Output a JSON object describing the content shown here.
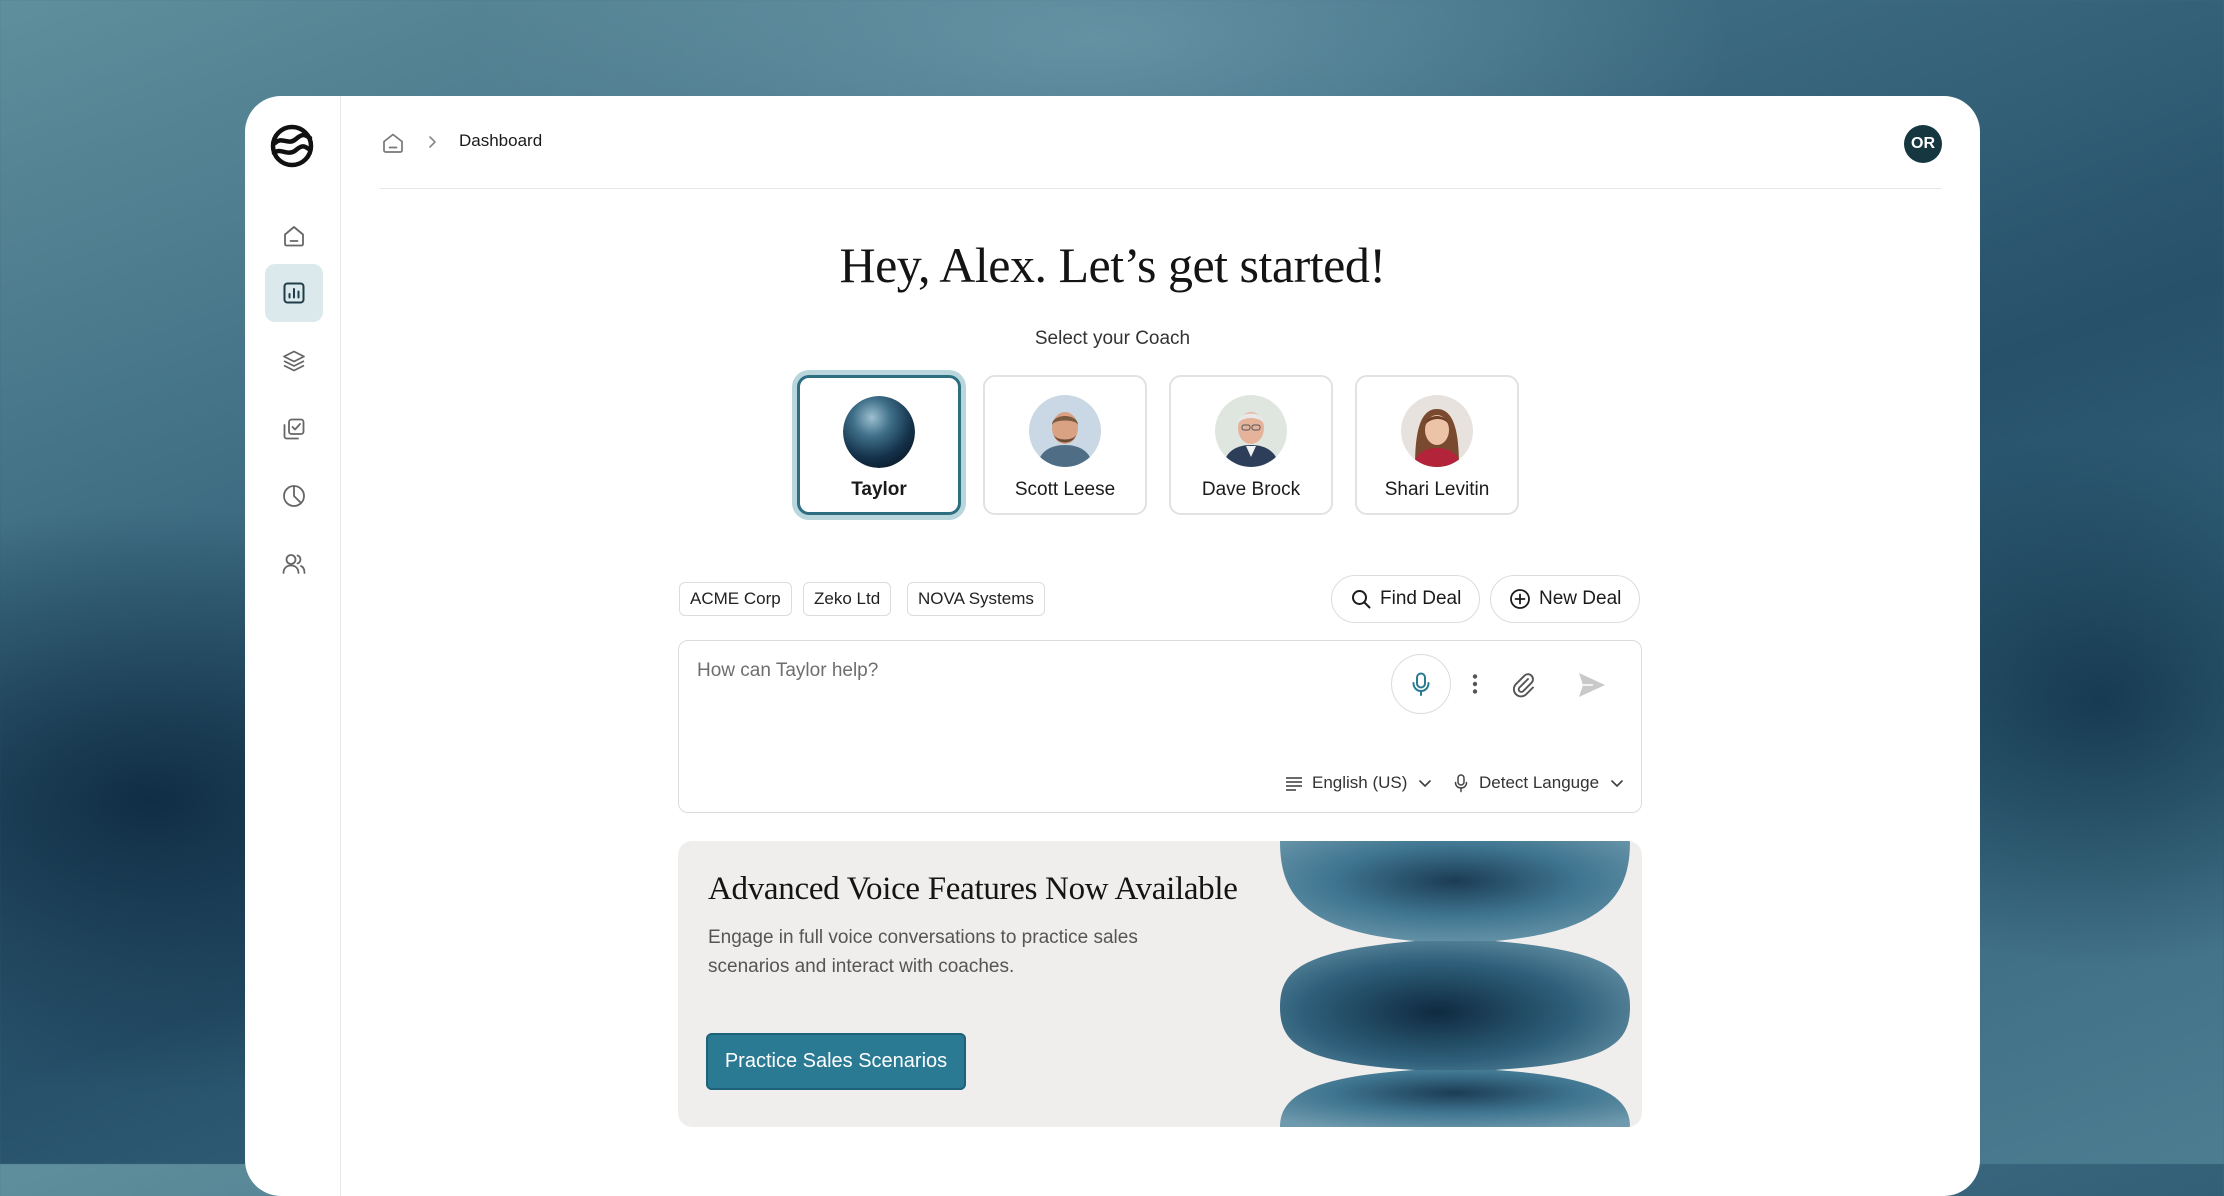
{
  "breadcrumb": {
    "current": "Dashboard"
  },
  "user": {
    "initials": "OR"
  },
  "sidebar": {
    "items": [
      {
        "icon": "home-icon",
        "active": false
      },
      {
        "icon": "dashboard-chart-icon",
        "active": true
      },
      {
        "icon": "layers-icon",
        "active": false
      },
      {
        "icon": "tasks-icon",
        "active": false
      },
      {
        "icon": "pie-chart-icon",
        "active": false
      },
      {
        "icon": "users-icon",
        "active": false
      }
    ]
  },
  "main": {
    "greeting": "Hey, Alex. Let’s get started!",
    "coach_prompt": "Select your Coach",
    "coaches": [
      {
        "name": "Taylor",
        "selected": true
      },
      {
        "name": "Scott Leese",
        "selected": false
      },
      {
        "name": "Dave Brock",
        "selected": false
      },
      {
        "name": "Shari Levitin",
        "selected": false
      }
    ],
    "deal_chips": [
      "ACME Corp",
      "Zeko Ltd",
      "NOVA Systems"
    ],
    "find_deal_label": "Find Deal",
    "new_deal_label": "New Deal"
  },
  "composer": {
    "placeholder": "How can Taylor help?",
    "language": "English (US)",
    "voice_language": "Detect Languge"
  },
  "banner": {
    "title": "Advanced Voice Features Now Available",
    "text": "Engage in full voice conversations to practice sales scenarios and interact with coaches.",
    "cta_label": "Practice Sales Scenarios"
  },
  "colors": {
    "accent": "#2a7a93",
    "active_nav": "#dce9ec",
    "avatar_bg": "#163640",
    "selected_ring": "#b9d6dd"
  }
}
